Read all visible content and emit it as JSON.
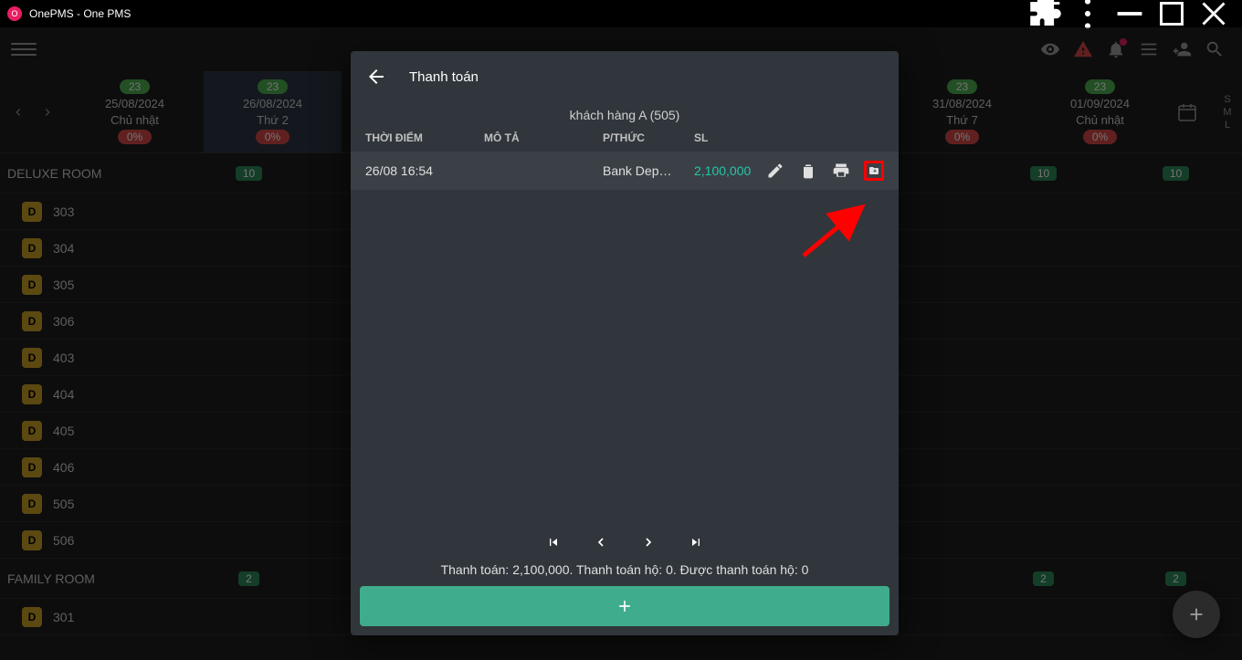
{
  "titlebar": {
    "title": "OnePMS - One PMS"
  },
  "header": {},
  "dates": [
    {
      "count": "23",
      "date": "25/08/2024",
      "day": "Chủ nhật",
      "pct": "0%",
      "selected": false
    },
    {
      "count": "23",
      "date": "26/08/2024",
      "day": "Thứ 2",
      "pct": "0%",
      "selected": true
    },
    {
      "count": "",
      "date": "",
      "day": "",
      "pct": "",
      "selected": false
    },
    {
      "count": "",
      "date": "",
      "day": "",
      "pct": "",
      "selected": false
    },
    {
      "count": "",
      "date": "",
      "day": "",
      "pct": "",
      "selected": false
    },
    {
      "count": "",
      "date": "",
      "day": "",
      "pct": "",
      "selected": false
    },
    {
      "count": "23",
      "date": "31/08/2024",
      "day": "Thứ 7",
      "pct": "0%",
      "selected": false
    },
    {
      "count": "23",
      "date": "01/09/2024",
      "day": "Chủ nhật",
      "pct": "0%",
      "selected": false
    }
  ],
  "sml": [
    "S",
    "M",
    "L"
  ],
  "categories": [
    {
      "name": "DELUXE ROOM",
      "counts": [
        "10",
        "",
        "",
        "",
        "",
        "",
        "10",
        "10"
      ],
      "rooms": [
        "303",
        "304",
        "305",
        "306",
        "403",
        "404",
        "405",
        "406",
        "505",
        "506"
      ]
    },
    {
      "name": "FAMILY ROOM",
      "counts": [
        "2",
        "",
        "",
        "",
        "",
        "",
        "2",
        "2"
      ],
      "rooms": [
        "301"
      ]
    }
  ],
  "room_chip": "D",
  "modal": {
    "title": "Thanh toán",
    "customer": "khách hàng A (505)",
    "cols": {
      "time": "THỜI ĐIỂM",
      "desc": "MÔ TẢ",
      "method": "P/THỨC",
      "sl": "SL"
    },
    "row": {
      "time": "26/08 16:54",
      "desc": "",
      "method": "Bank Dep…",
      "amount": "2,100,000"
    },
    "summary": "Thanh toán: 2,100,000.  Thanh toán hộ:  0.   Được thanh toán hộ:  0"
  }
}
